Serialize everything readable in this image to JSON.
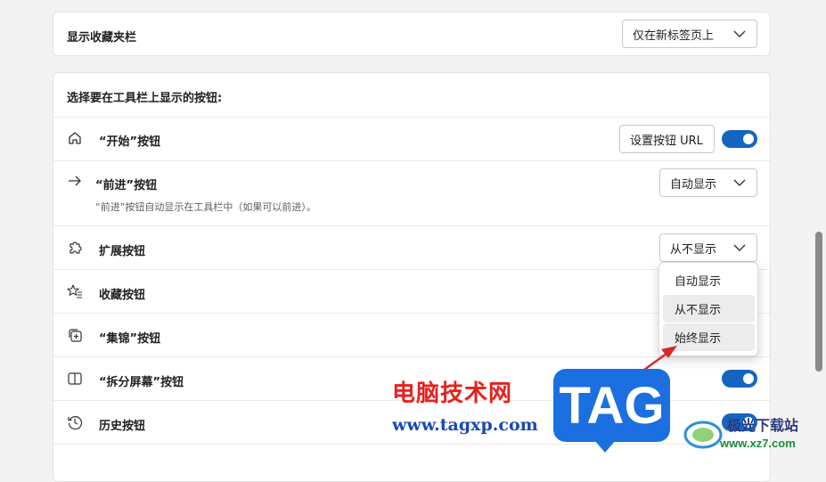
{
  "favorites_bar": {
    "label": "显示收藏夹栏",
    "value": "仅在新标签页上"
  },
  "toolbar_section": {
    "heading": "选择要在工具栏上显示的按钮:",
    "rows": {
      "home": {
        "label": "“开始”按钮",
        "url_button": "设置按钮 URL",
        "toggle_on": true
      },
      "forward": {
        "label": "“前进”按钮",
        "value": "自动显示",
        "description": "“前进”按钮自动显示在工具栏中（如果可以前进）。"
      },
      "extensions": {
        "label": "扩展按钮",
        "value": "从不显示"
      },
      "favorites": {
        "label": "收藏按钮"
      },
      "collections": {
        "label": "“集锦”按钮"
      },
      "split_screen": {
        "label": "“拆分屏幕”按钮",
        "toggle_on": true
      },
      "history": {
        "label": "历史按钮",
        "toggle_on": true
      }
    }
  },
  "dropdown_menu": {
    "options": [
      "自动显示",
      "从不显示",
      "始终显示"
    ],
    "highlighted": [
      "从不显示",
      "始终显示"
    ]
  },
  "watermarks": {
    "site_name": "电脑技术网",
    "site_url": "www.tagxp.com",
    "tag_logo": "TAG",
    "xz_name": "极光下载站",
    "xz_url": "www.xz7.com"
  },
  "colors": {
    "toggle_on": "#1565c0",
    "watermark_red": "#e8201c",
    "watermark_blue": "#1a49b5",
    "tag_logo_bg": "#1b6fe0"
  }
}
